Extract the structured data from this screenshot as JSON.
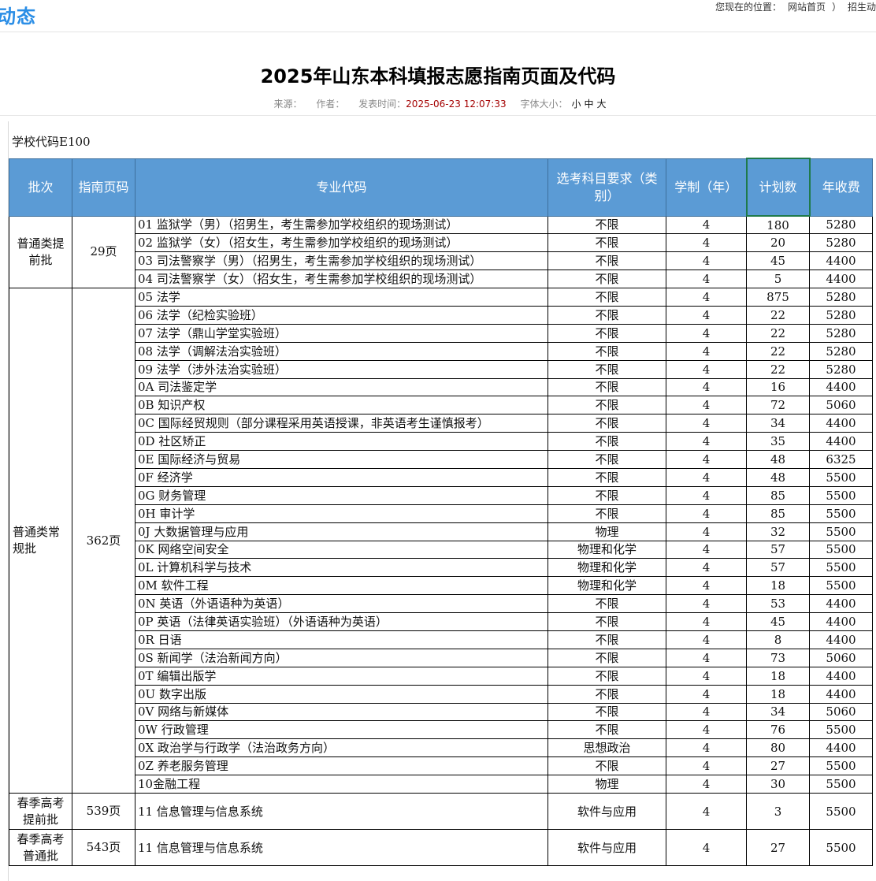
{
  "header": {
    "section_heading": "动态",
    "breadcrumb": [
      "您现在的位置：",
      "网站首页",
      "）",
      "招生动"
    ]
  },
  "article": {
    "title": "2025年山东本科填报志愿指南页面及代码",
    "meta": {
      "source_label": "来源：",
      "author_label": "作者：",
      "date_label": "发表时间：",
      "date": "2025-06-23 12:07:33",
      "fontsize_label": "字体大小：",
      "sizes": [
        "小",
        "中",
        "大"
      ]
    },
    "school_code": "学校代码E100"
  },
  "table": {
    "headers": [
      "批次",
      "指南页码",
      "专业代码",
      "选考科目要求（类别）",
      "学制（年）",
      "计划数",
      "年收费"
    ],
    "selected_header": 5,
    "groups": [
      {
        "batch": "普通类提前批",
        "page": "29页",
        "rows": [
          {
            "major": "01 监狱学（男）（招男生，考生需参加学校组织的现场测试）",
            "req": "不限",
            "years": "4",
            "plan": "180",
            "fee": "5280"
          },
          {
            "major": "02 监狱学（女）（招女生，考生需参加学校组织的现场测试）",
            "req": "不限",
            "years": "4",
            "plan": "20",
            "fee": "5280"
          },
          {
            "major": "03 司法警察学（男）（招男生，考生需参加学校组织的现场测试）",
            "req": "不限",
            "years": "4",
            "plan": "45",
            "fee": "4400"
          },
          {
            "major": "04 司法警察学（女）（招女生，考生需参加学校组织的现场测试）",
            "req": "不限",
            "years": "4",
            "plan": "5",
            "fee": "4400"
          }
        ]
      },
      {
        "batch": "普通类常规批",
        "page": "362页",
        "rows": [
          {
            "major": "05 法学",
            "req": "不限",
            "years": "4",
            "plan": "875",
            "fee": "5280"
          },
          {
            "major": "06 法学（纪检实验班）",
            "req": "不限",
            "years": "4",
            "plan": "22",
            "fee": "5280"
          },
          {
            "major": "07 法学（鼎山学堂实验班）",
            "req": "不限",
            "years": "4",
            "plan": "22",
            "fee": "5280"
          },
          {
            "major": "08 法学（调解法治实验班）",
            "req": "不限",
            "years": "4",
            "plan": "22",
            "fee": "5280"
          },
          {
            "major": "09 法学（涉外法治实验班）",
            "req": "不限",
            "years": "4",
            "plan": "22",
            "fee": "5280"
          },
          {
            "major": "0A 司法鉴定学",
            "req": "不限",
            "years": "4",
            "plan": "16",
            "fee": "4400"
          },
          {
            "major": "0B 知识产权",
            "req": "不限",
            "years": "4",
            "plan": "72",
            "fee": "5060"
          },
          {
            "major": "0C 国际经贸规则（部分课程采用英语授课，非英语考生谨慎报考）",
            "req": "不限",
            "years": "4",
            "plan": "34",
            "fee": "4400"
          },
          {
            "major": "0D 社区矫正",
            "req": "不限",
            "years": "4",
            "plan": "35",
            "fee": "4400"
          },
          {
            "major": "0E 国际经济与贸易",
            "req": "不限",
            "years": "4",
            "plan": "48",
            "fee": "6325"
          },
          {
            "major": "0F 经济学",
            "req": "不限",
            "years": "4",
            "plan": "48",
            "fee": "5500"
          },
          {
            "major": "0G 财务管理",
            "req": "不限",
            "years": "4",
            "plan": "85",
            "fee": "5500"
          },
          {
            "major": "0H 审计学",
            "req": "不限",
            "years": "4",
            "plan": "85",
            "fee": "5500"
          },
          {
            "major": "0J 大数据管理与应用",
            "req": "物理",
            "years": "4",
            "plan": "32",
            "fee": "5500"
          },
          {
            "major": "0K 网络空间安全",
            "req": "物理和化学",
            "years": "4",
            "plan": "57",
            "fee": "5500"
          },
          {
            "major": "0L 计算机科学与技术",
            "req": "物理和化学",
            "years": "4",
            "plan": "57",
            "fee": "5500"
          },
          {
            "major": "0M 软件工程",
            "req": "物理和化学",
            "years": "4",
            "plan": "18",
            "fee": "5500"
          },
          {
            "major": "0N 英语（外语语种为英语）",
            "req": "不限",
            "years": "4",
            "plan": "53",
            "fee": "4400"
          },
          {
            "major": "0P 英语（法律英语实验班）（外语语种为英语）",
            "req": "不限",
            "years": "4",
            "plan": "45",
            "fee": "4400"
          },
          {
            "major": "0R 日语",
            "req": "不限",
            "years": "4",
            "plan": "8",
            "fee": "4400"
          },
          {
            "major": "0S 新闻学（法治新闻方向）",
            "req": "不限",
            "years": "4",
            "plan": "73",
            "fee": "5060"
          },
          {
            "major": "0T 编辑出版学",
            "req": "不限",
            "years": "4",
            "plan": "18",
            "fee": "4400"
          },
          {
            "major": "0U 数字出版",
            "req": "不限",
            "years": "4",
            "plan": "18",
            "fee": "4400"
          },
          {
            "major": "0V 网络与新媒体",
            "req": "不限",
            "years": "4",
            "plan": "34",
            "fee": "5060"
          },
          {
            "major": "0W 行政管理",
            "req": "不限",
            "years": "4",
            "plan": "76",
            "fee": "5500"
          },
          {
            "major": "0X 政治学与行政学（法治政务方向）",
            "req": "思想政治",
            "years": "4",
            "plan": "80",
            "fee": "4400"
          },
          {
            "major": "0Z 养老服务管理",
            "req": "不限",
            "years": "4",
            "plan": "27",
            "fee": "5500"
          },
          {
            "major": "10金融工程",
            "req": "物理",
            "years": "4",
            "plan": "30",
            "fee": "5500"
          }
        ]
      },
      {
        "batch": "春季高考提前批",
        "page": "539页",
        "tall": true,
        "rows": [
          {
            "major": "11 信息管理与信息系统",
            "req": "软件与应用",
            "years": "4",
            "plan": "3",
            "fee": "5500"
          }
        ]
      },
      {
        "batch": "春季高考普通批",
        "page": "543页",
        "tall": true,
        "rows": [
          {
            "major": "11 信息管理与信息系统",
            "req": "软件与应用",
            "years": "4",
            "plan": "27",
            "fee": "5500"
          }
        ]
      }
    ]
  }
}
